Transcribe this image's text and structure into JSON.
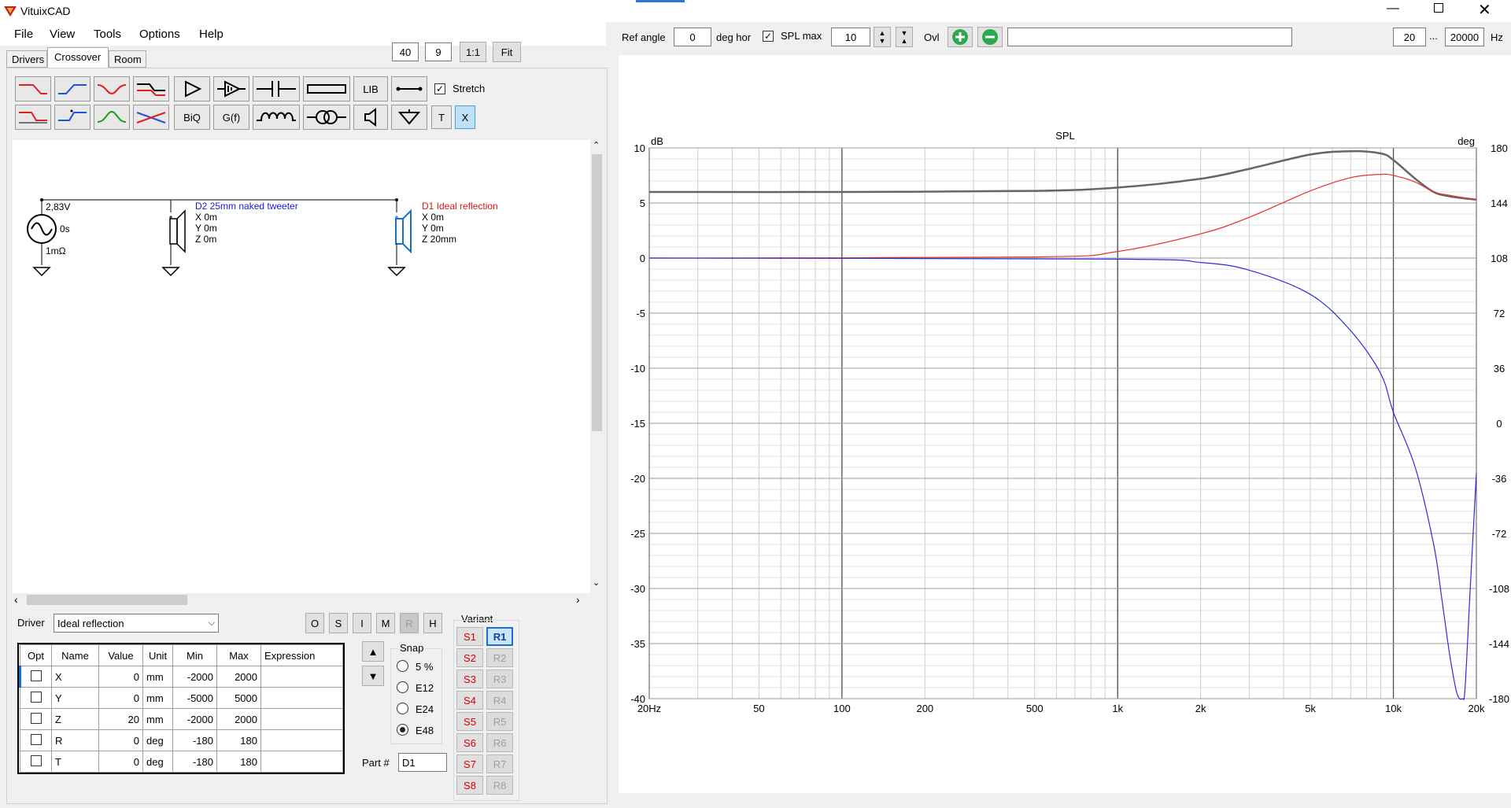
{
  "window": {
    "title": "VituixCAD"
  },
  "menu": [
    "File",
    "View",
    "Tools",
    "Options",
    "Help"
  ],
  "zoom": {
    "a": "40",
    "b": "9",
    "one": "1:1",
    "fit": "Fit"
  },
  "tabs": [
    "Drivers",
    "Crossover",
    "Room"
  ],
  "toolbar": {
    "lib": "LIB",
    "biq": "BiQ",
    "gf": "G(f)",
    "t": "T",
    "x": "X",
    "stretch": "Stretch",
    "stretch_checked": true
  },
  "schematic": {
    "source": {
      "voltage": "2,83V",
      "delay": "0s",
      "resistance": "1mΩ"
    },
    "d2": {
      "name": "D2 25mm naked tweeter",
      "x": "X 0m",
      "y": "Y 0m",
      "z": "Z 0m",
      "color": "#1a1adb"
    },
    "d1": {
      "name": "D1 Ideal reflection",
      "x": "X 0m",
      "y": "Y 0m",
      "z": "Z 20mm",
      "color": "#e01818"
    }
  },
  "driver": {
    "label": "Driver",
    "selected": "Ideal reflection"
  },
  "mode_buttons": [
    "O",
    "S",
    "I",
    "M",
    "R",
    "H"
  ],
  "params": {
    "headers": [
      "Opt",
      "Name",
      "Value",
      "Unit",
      "Min",
      "Max",
      "Expression"
    ],
    "rows": [
      {
        "name": "X",
        "value": "0",
        "unit": "mm",
        "min": "-2000",
        "max": "2000",
        "expr": ""
      },
      {
        "name": "Y",
        "value": "0",
        "unit": "mm",
        "min": "-5000",
        "max": "5000",
        "expr": ""
      },
      {
        "name": "Z",
        "value": "20",
        "unit": "mm",
        "min": "-2000",
        "max": "2000",
        "expr": ""
      },
      {
        "name": "R",
        "value": "0",
        "unit": "deg",
        "min": "-180",
        "max": "180",
        "expr": ""
      },
      {
        "name": "T",
        "value": "0",
        "unit": "deg",
        "min": "-180",
        "max": "180",
        "expr": ""
      }
    ]
  },
  "snap": {
    "label": "Snap",
    "options": [
      "5 %",
      "E12",
      "E24",
      "E48"
    ],
    "selected": "E48"
  },
  "part": {
    "label": "Part #",
    "value": "D1"
  },
  "variant": {
    "label": "Variant",
    "s": [
      "S1",
      "S2",
      "S3",
      "S4",
      "S5",
      "S6",
      "S7",
      "S8"
    ],
    "r": [
      "R1",
      "R2",
      "R3",
      "R4",
      "R5",
      "R6",
      "R7",
      "R8"
    ],
    "active": "R1"
  },
  "topbar": {
    "ref_angle_label": "Ref angle",
    "ref_angle": "0",
    "deg_hor": "deg hor",
    "spl_max_label": "SPL max",
    "spl_max": "10",
    "spl_max_checked": true,
    "ovl": "Ovl",
    "freq_from": "20",
    "ellipsis": "...",
    "freq_to": "20000",
    "hz": "Hz"
  },
  "chart_data": {
    "type": "line",
    "title": "SPL",
    "ylabel": "dB",
    "y2label": "deg",
    "xscale": "log",
    "xlim": [
      20,
      20000
    ],
    "ylim": [
      -40,
      10
    ],
    "y2lim": [
      -180,
      180
    ],
    "xticks": [
      20,
      50,
      100,
      200,
      500,
      1000,
      2000,
      5000,
      10000,
      20000
    ],
    "xticklabels": [
      "20Hz",
      "50",
      "100",
      "200",
      "500",
      "1k",
      "2k",
      "5k",
      "10k",
      "20k"
    ],
    "yticks": [
      10,
      5,
      0,
      -5,
      -10,
      -15,
      -20,
      -25,
      -30,
      -35,
      -40
    ],
    "y2ticks": [
      180,
      144,
      108,
      72,
      36,
      0,
      -36,
      -72,
      -108,
      -144,
      -180
    ],
    "grid": true,
    "series": [
      {
        "color": "#666666",
        "width": 2.5,
        "x": [
          20,
          100,
          500,
          1000,
          2000,
          3000,
          5000,
          7000,
          9000,
          10000,
          12000,
          14000,
          16000,
          20000
        ],
        "y": [
          6,
          6,
          6.1,
          6.4,
          7.2,
          8.1,
          9.4,
          9.7,
          9.5,
          8.9,
          7.2,
          6,
          5.6,
          5.3
        ]
      },
      {
        "color": "#e83030",
        "width": 1.2,
        "x": [
          20,
          500,
          1000,
          2000,
          3000,
          5000,
          7000,
          9000,
          10000,
          12000,
          14000,
          16000,
          20000
        ],
        "y": [
          0,
          0.1,
          0.6,
          2.2,
          3.7,
          6.1,
          7.3,
          7.6,
          7.5,
          6.9,
          6,
          5.7,
          5.3
        ]
      },
      {
        "color": "#2c2ce0",
        "width": 1.2,
        "x": [
          20,
          1000,
          2000,
          3000,
          5000,
          7000,
          9000,
          10000,
          12000,
          14000,
          15000,
          16000,
          17000,
          17800,
          18200,
          19000,
          20000
        ],
        "y": [
          0,
          -0.1,
          -0.4,
          -1.1,
          -3.3,
          -6.6,
          -10.5,
          -14,
          -19,
          -26,
          -31,
          -36,
          -39.5,
          -40,
          -39,
          -30,
          -19.5
        ]
      }
    ]
  }
}
